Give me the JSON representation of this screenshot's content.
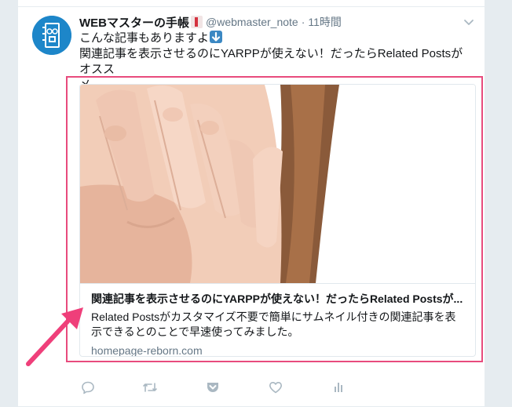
{
  "tweet": {
    "author_name": "WEBマスターの手帳",
    "handle": "@webmaster_note",
    "separator": "·",
    "time": "11時間",
    "text_line1": "こんな記事もありますよ",
    "text_line2": "関連記事を表示させるのにYARPPが使えない！だったらRelated Postsがオスス",
    "text_line3": "メ"
  },
  "card": {
    "title": "関連記事を表示させるのにYARPPが使えない！だったらRelated Postsが...",
    "description": "Related Postsがカスタマイズ不要で簡単にサムネイル付きの関連記事を表示できるとのことで早速使ってみました。",
    "domain": "homepage-reborn.com"
  },
  "icons": {
    "reply": "reply-icon",
    "retweet": "retweet-icon",
    "pocket": "pocket-icon",
    "like": "heart-icon",
    "analytics": "analytics-icon",
    "caret": "chevron-down-icon"
  },
  "colors": {
    "highlight": "#e84b7d",
    "icon_gray": "#aab8c2",
    "avatar_blue": "#1d86c9",
    "text_secondary": "#657786"
  }
}
